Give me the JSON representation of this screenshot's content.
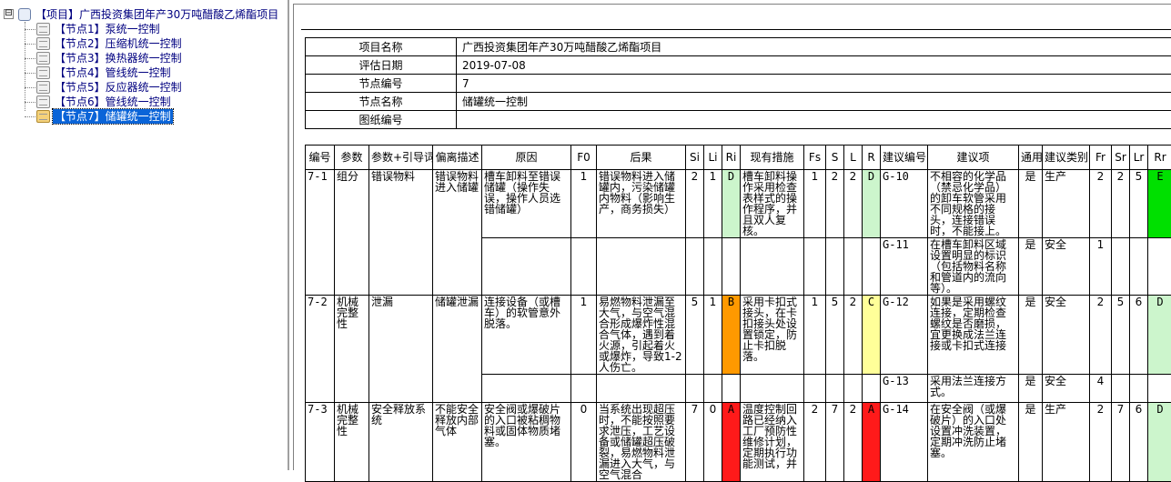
{
  "tree": {
    "root": "【项目】广西投资集团年产30万吨醋酸乙烯酯项目",
    "expander_symbol": "⊟",
    "nodes": [
      {
        "label": "【节点1】泵统一控制",
        "selected": false
      },
      {
        "label": "【节点2】压缩机统一控制",
        "selected": false
      },
      {
        "label": "【节点3】换热器统一控制",
        "selected": false
      },
      {
        "label": "【节点4】管线统一控制",
        "selected": false
      },
      {
        "label": "【节点5】反应器统一控制",
        "selected": false
      },
      {
        "label": "【节点6】管线统一控制",
        "selected": false
      },
      {
        "label": "【节点7】储罐统一控制",
        "selected": true
      }
    ]
  },
  "info": {
    "project_name_label": "项目名称",
    "project_name": "广西投资集团年产30万吨醋酸乙烯酯项目",
    "eval_date_label": "评估日期",
    "eval_date": "2019-07-08",
    "node_no_label": "节点编号",
    "node_no": "7",
    "node_name_label": "节点名称",
    "node_name": "储罐统一控制",
    "drawing_no_label": "图纸编号",
    "drawing_no": ""
  },
  "table": {
    "headers": [
      "编号",
      "参数",
      "参数+引导词",
      "偏离描述",
      "原因",
      "F0",
      "后果",
      "Si",
      "Li",
      "Ri",
      "现有措施",
      "Fs",
      "S",
      "L",
      "R",
      "建议编号",
      "建议项",
      "通用",
      "建议类别",
      "Fr",
      "Sr",
      "Lr",
      "Rr"
    ],
    "rows": [
      {
        "id": "7-1",
        "param": "组分",
        "guide": "错误物料",
        "deviation": "错误物料进入储罐",
        "cause": "槽车卸料至错误储罐（操作失误，操作人员选错储罐）",
        "f0": "1",
        "consequence": "错误物料进入储罐内，污染储罐内物料（影响生产，商务损失）",
        "si": "2",
        "li": "1",
        "ri": "D",
        "measure": "槽车卸料操作采用检查表样式的操作程序，并且双人复核。",
        "fs": "1",
        "s": "2",
        "l": "2",
        "r": "D",
        "rec_no": "G-10",
        "rec": "不相容的化学品（禁忌化学品）的卸车软管采用不同规格的接头，连接错误时，不能接上。",
        "general": "是",
        "category": "生产",
        "fr": "2",
        "sr": "2",
        "lr": "5",
        "rr": "E",
        "rec2_no": "G-11",
        "rec2": "在槽车卸料区域设置明显的标识（包括物料名称和管道内的流向等）。",
        "general2": "是",
        "category2": "安全",
        "fr2": "1"
      },
      {
        "id": "7-2",
        "param": "机械完整性",
        "guide": "泄漏",
        "deviation": "储罐泄漏",
        "cause": "连接设备（或槽车）的软管意外脱落。",
        "f0": "1",
        "consequence": "易燃物料泄漏至大气，与空气混合形成爆炸性混合气体，遇到着火源，引起着火或爆炸，导致1-2人伤亡。",
        "si": "5",
        "li": "1",
        "ri": "B",
        "measure": "采用卡扣式接头，在卡扣接头处设置锁定，防止卡扣脱落。",
        "fs": "1",
        "s": "5",
        "l": "2",
        "r": "C",
        "rec_no": "G-12",
        "rec": "如果是采用螺纹连接，定期检查螺纹是否磨损，宜更换成法兰连接或卡扣式连接",
        "general": "是",
        "category": "安全",
        "fr": "2",
        "sr": "5",
        "lr": "6",
        "rr": "D",
        "rec2_no": "G-13",
        "rec2": "采用法兰连接方式。",
        "general2": "是",
        "category2": "安全",
        "fr2": "4"
      },
      {
        "id": "7-3",
        "param": "机械完整性",
        "guide": "安全释放系统",
        "deviation": "不能安全释放内部气体",
        "cause": "安全阀或爆破片的入口被粘稠物料或固体物质堵塞。",
        "f0": "0",
        "consequence": "当系统出现超压时，不能按照要求泄压，工艺设备或储罐超压破裂，易燃物料泄漏进入大气，与空气混合",
        "si": "7",
        "li": "0",
        "ri": "A",
        "measure": "温度控制回路已经纳入工厂预防性维修计划，定期执行功能测试，并",
        "fs": "2",
        "s": "7",
        "l": "2",
        "r": "A",
        "rec_no": "G-14",
        "rec": "在安全阀（或爆破片）的入口处设置冲洗装置，定期冲洗防止堵塞。",
        "general": "是",
        "category": "生产",
        "fr": "2",
        "sr": "7",
        "lr": "6",
        "rr": "D"
      }
    ]
  },
  "colors": {
    "risk_D": "#ccf5cc",
    "risk_E": "#00e000",
    "risk_B": "#ff9900",
    "risk_C": "#ffff99",
    "risk_A": "#ff1a1a",
    "selected": "#0a64d8",
    "tree_text": "#000080"
  }
}
